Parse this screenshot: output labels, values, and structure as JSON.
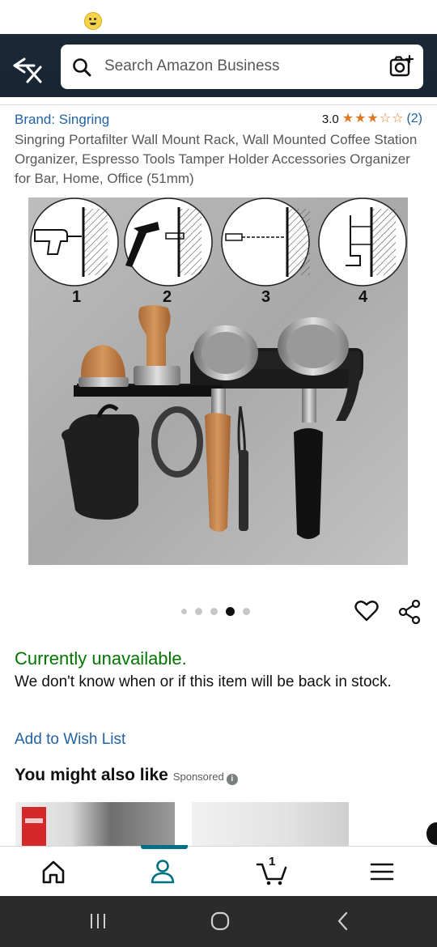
{
  "search": {
    "placeholder": "Search Amazon Business"
  },
  "product": {
    "brand": "Brand: Singring",
    "rating_value": "3.0",
    "rating_stars": 3,
    "rating_count": "(2)",
    "title": "Singring Portafilter Wall Mount Rack, Wall Mounted Coffee Station Organizer, Espresso Tools Tamper Holder Accessories Organizer for Bar, Home, Office (51mm)",
    "image": {
      "step_labels": [
        "1",
        "2",
        "3",
        "4"
      ]
    },
    "carousel": {
      "total": 5,
      "active_index": 3
    },
    "availability": "Currently unavailable.",
    "availability_message": "We don't know when or if this item will be back in stock.",
    "wishlist_label": "Add to Wish List"
  },
  "recommendations": {
    "title": "You might also like",
    "sponsored_label": "Sponsored",
    "info_glyph": "i"
  },
  "bottom_nav": {
    "items": [
      "home-icon",
      "account-icon",
      "cart-icon",
      "menu-icon"
    ],
    "active": "account-icon",
    "cart_count": "1"
  },
  "colors": {
    "header": "#172534",
    "link": "#2162a1",
    "unavailable": "#007600",
    "star": "#de7921",
    "nav_indicator": "#007185"
  }
}
